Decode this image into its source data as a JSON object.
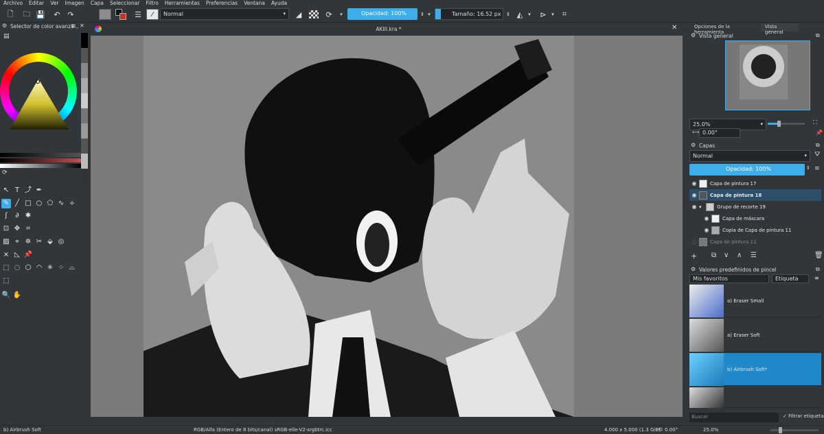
{
  "menu": [
    "Archivo",
    "Editar",
    "Ver",
    "Imagen",
    "Capa",
    "Seleccionar",
    "Filtro",
    "Herramientas",
    "Preferencias",
    "Ventana",
    "Ayuda"
  ],
  "toolbar": {
    "blend_mode": "Normal",
    "opacity": "Opacidad: 100%",
    "size": "Tamaño: 16.52 px",
    "opacity_fraction": 1.0,
    "size_fraction": 0.08
  },
  "colors": {
    "accent": "#3daee9",
    "bg": "#31363b",
    "canvas_bg": "#7a7a7a",
    "dark": "#232629"
  },
  "left_panel": {
    "title": "Selector de color avanza..."
  },
  "document": {
    "tab_title": "AKIII.kra *"
  },
  "right_tabs": [
    "Opciones de la herramienta",
    "Vista general"
  ],
  "overview": {
    "title": "Vista general",
    "zoom": "25.0%",
    "rotation": "0.00°"
  },
  "layers": {
    "title": "Capas",
    "blend_mode": "Normal",
    "opacity": "Opacidad:  100%",
    "items": [
      {
        "name": "Capa de pintura 17",
        "selected": false,
        "visible": true
      },
      {
        "name": "Capa de pintura 18",
        "selected": true,
        "visible": true
      },
      {
        "name": "Grupo de recorte 19",
        "selected": false,
        "visible": true
      },
      {
        "name": "Capa de máscara",
        "selected": false,
        "visible": true
      },
      {
        "name": "Copia de Capa de pintura 11",
        "selected": false,
        "visible": true
      },
      {
        "name": "Capa de pintura 11",
        "selected": false,
        "visible": false
      }
    ]
  },
  "brushes": {
    "title": "Valores predefinidos de pincel",
    "filter": "Mis favoritos",
    "tag_button": "Etiqueta",
    "items": [
      {
        "name": "a) Eraser Small",
        "selected": false
      },
      {
        "name": "a) Eraser Soft",
        "selected": false
      },
      {
        "name": "b) Airbrush Soft*",
        "selected": true
      }
    ],
    "search_placeholder": "Buscar",
    "filter_tag": "Filtrar etiqueta"
  },
  "status": {
    "brush": "b) Airbrush Soft",
    "colorspace": "RGB/Alfa (Entero de 8 bits/canal)  sRGB-elle-V2-srgbtrc.icc",
    "dimensions": "4.000 x 5.000 (1.3 GiB)",
    "rotation": "0.00°",
    "zoom": "25.0%"
  }
}
